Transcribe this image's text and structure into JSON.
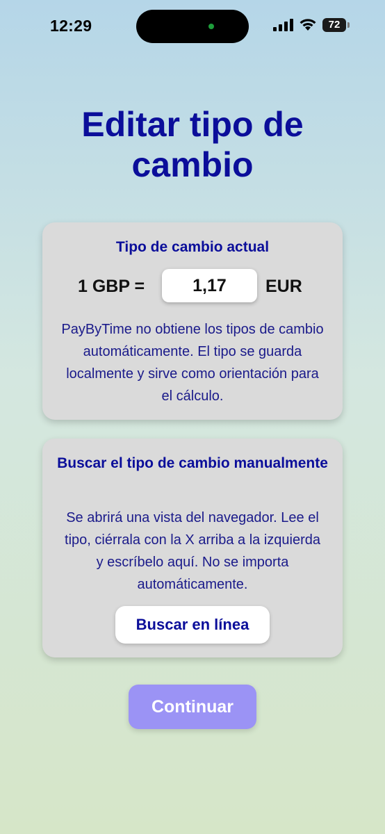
{
  "status_bar": {
    "time": "12:29",
    "battery": "72",
    "island_dot_color": "#1e9d3b"
  },
  "page": {
    "title": "Editar tipo de cambio"
  },
  "current_rate_card": {
    "title": "Tipo de cambio actual",
    "prefix": "1 GBP =",
    "rate_value": "1,17",
    "suffix": "EUR",
    "description": "PayByTime no obtiene los tipos de cambio automáticamente. El tipo se guarda localmente y sirve como orientación para el cálculo."
  },
  "search_card": {
    "title": "Buscar el tipo de cambio manualmente",
    "description": "Se abrirá una vista del navegador. Lee el tipo, ciérrala con la X arriba a la izquierda y escríbelo aquí. No se importa automáticamente.",
    "button_label": "Buscar en línea"
  },
  "footer": {
    "continue_label": "Continuar"
  },
  "colors": {
    "title": "#0b0e9a",
    "card_bg": "#dadada",
    "continue_bg": "#9b93f5"
  }
}
